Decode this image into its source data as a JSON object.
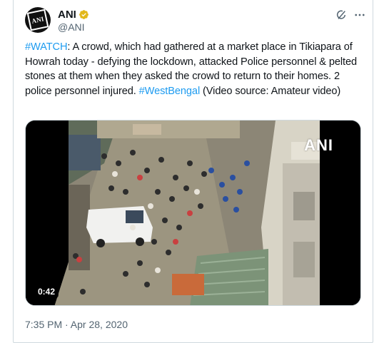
{
  "author": {
    "display_name": "ANI",
    "handle": "@ANI",
    "avatar_text": "ANI",
    "verified_badge": "verified-gold-icon"
  },
  "tweet": {
    "segments": [
      {
        "type": "hashtag",
        "text": "#WATCH"
      },
      {
        "type": "text",
        "text": ": A crowd, which had gathered at a market place in Tikiapara of Howrah today - defying the lockdown, attacked Police personnel & pelted stones at them when they asked the crowd to return to their homes. 2 police personnel injured. "
      },
      {
        "type": "hashtag",
        "text": "#WestBengal"
      },
      {
        "type": "text",
        "text": " (Video source: Amateur video)"
      }
    ]
  },
  "media": {
    "duration": "0:42",
    "watermark": "ANI"
  },
  "timestamp": "7:35 PM · Apr 28, 2020",
  "colors": {
    "accent": "#1d9bf0",
    "text": "#0f1419",
    "secondary": "#536471",
    "verified_gold": "#e2b719"
  },
  "icons": {
    "grok": "grok-icon",
    "more": "more-icon"
  }
}
